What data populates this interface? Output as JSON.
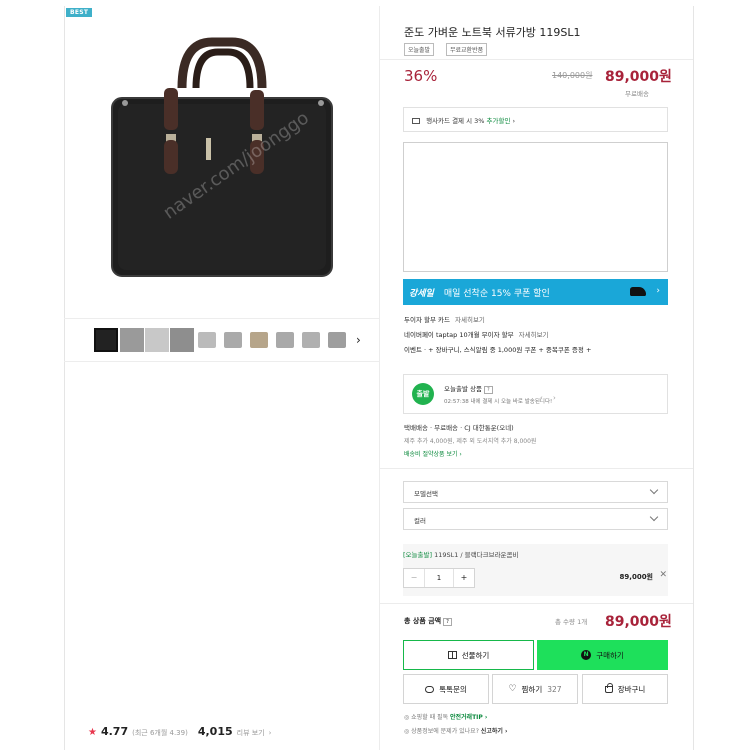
{
  "left": {
    "badge": "BEST",
    "watermark": "naver.com/joonggo",
    "rating": {
      "star": "★",
      "value": "4.77",
      "recent_note": "(최근 6개월 4.39)",
      "review_count": "4,015",
      "review_label": "리뷰 보기",
      "review_arrow": "›"
    },
    "thumb_next": "›"
  },
  "product": {
    "title": "준도 가벼운 노트북 서류가방 119SL1",
    "tags": [
      "오늘출발",
      "무료교환반품"
    ],
    "discount": "36%",
    "original_price": "140,000원",
    "sale_price": "89,000원",
    "shipping_badge": "무료배송"
  },
  "card_offer": {
    "text": "행사카드 결제 시 3% ",
    "highlight": "추가할인",
    "arrow": "›"
  },
  "promo": {
    "logo": "강세일",
    "text": "매일 선착순 15% 쿠폰 할인",
    "arrow": "›"
  },
  "benefits": [
    {
      "label": "두이자 할부 카드",
      "link": "자세히보기"
    },
    {
      "label": "네이버페이 taptap 10개월 무이자 할부",
      "link": "자세히보기"
    },
    {
      "label": "이벤트 · + 장바구니, 스식알림 중 1,000원 쿠폰 + 중복쿠폰 증정 +",
      "link": ""
    }
  ],
  "today": {
    "icon_text": "출발",
    "title": "오늘출발 상품",
    "q": "?",
    "subtitle": "02:57:38 내에 결제 시 오늘 바로 발송된니다!",
    "pager": "‹ ›"
  },
  "shipping": {
    "line1": "택배배송 · 무료배송 · CJ 대한통운(오네)",
    "line2": "제주 추가 4,000원, 제주 외 도서지역 추가 8,000원",
    "line3": "배송비 절약상품 보기 ›"
  },
  "options": {
    "model_placeholder": "모델선택",
    "color_placeholder": "컬러",
    "selected_prefix": "[오늘출발]",
    "selected_name": " 119SL1 / 블랙다크브라운콤비",
    "qty": "1",
    "minus": "−",
    "plus": "+",
    "price": "89,000원",
    "remove": "✕"
  },
  "total": {
    "label": "총 상품 금액",
    "q": "?",
    "count": "총 수량 1개",
    "price": "89,000원"
  },
  "buttons": {
    "gift": "선물하기",
    "buy": "구매하기",
    "buy_icon": "N",
    "talk": "톡톡문의",
    "zzim": "찜하기",
    "zzim_count": "327",
    "cart": "장바구니"
  },
  "footer": {
    "line1_prefix": "쇼핑할 때 필독 ",
    "line1_link": "안전거래TIP ›",
    "line2_prefix": "상품정보에 문제가 있나요? ",
    "line2_link": "신고하기 ›"
  },
  "colors": {
    "sale_red": "#a8233a",
    "naver_green": "#1ee05b",
    "promo_blue": "#1aa7d8"
  }
}
